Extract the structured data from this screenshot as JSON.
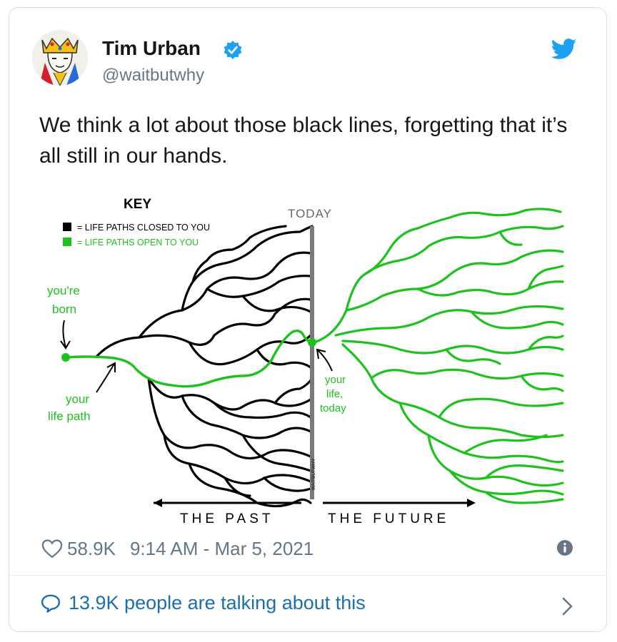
{
  "author": {
    "name": "Tim Urban",
    "handle": "@waitbutwhy",
    "verified": true,
    "avatar_icon": "king-card-avatar"
  },
  "icons": {
    "brand": "twitter-bird-icon",
    "verified": "verified-badge-icon",
    "like": "heart-icon",
    "info": "info-icon",
    "conversation": "speech-bubble-icon",
    "chevron": "chevron-right-icon"
  },
  "tweet": {
    "text": "We think a lot about those black lines, forgetting that it’s all still in our hands."
  },
  "illustration": {
    "key_title": "KEY",
    "key_closed": "= LIFE PATHS CLOSED TO YOU",
    "key_open": "= LIFE PATHS OPEN TO YOU",
    "today": "TODAY",
    "born_line1": "you're",
    "born_line2": "born",
    "path_line1": "your",
    "path_line2": "life path",
    "life_line1": "your",
    "life_line2": "life,",
    "life_line3": "today",
    "past": "THE PAST",
    "future": "THE FUTURE",
    "signature": "WAITBUTWHY",
    "colors": {
      "closed": "#000000",
      "open": "#1ec21e",
      "today_line": "#7a7a7a"
    }
  },
  "meta": {
    "likes": "58.9K",
    "timestamp": "9:14 AM - Mar 5, 2021"
  },
  "footer": {
    "talking": "13.9K people are talking about this"
  },
  "colors": {
    "accent": "#1da1f2",
    "link": "#1b6fae",
    "secondary_text": "#657786",
    "border": "#d9dee3"
  }
}
